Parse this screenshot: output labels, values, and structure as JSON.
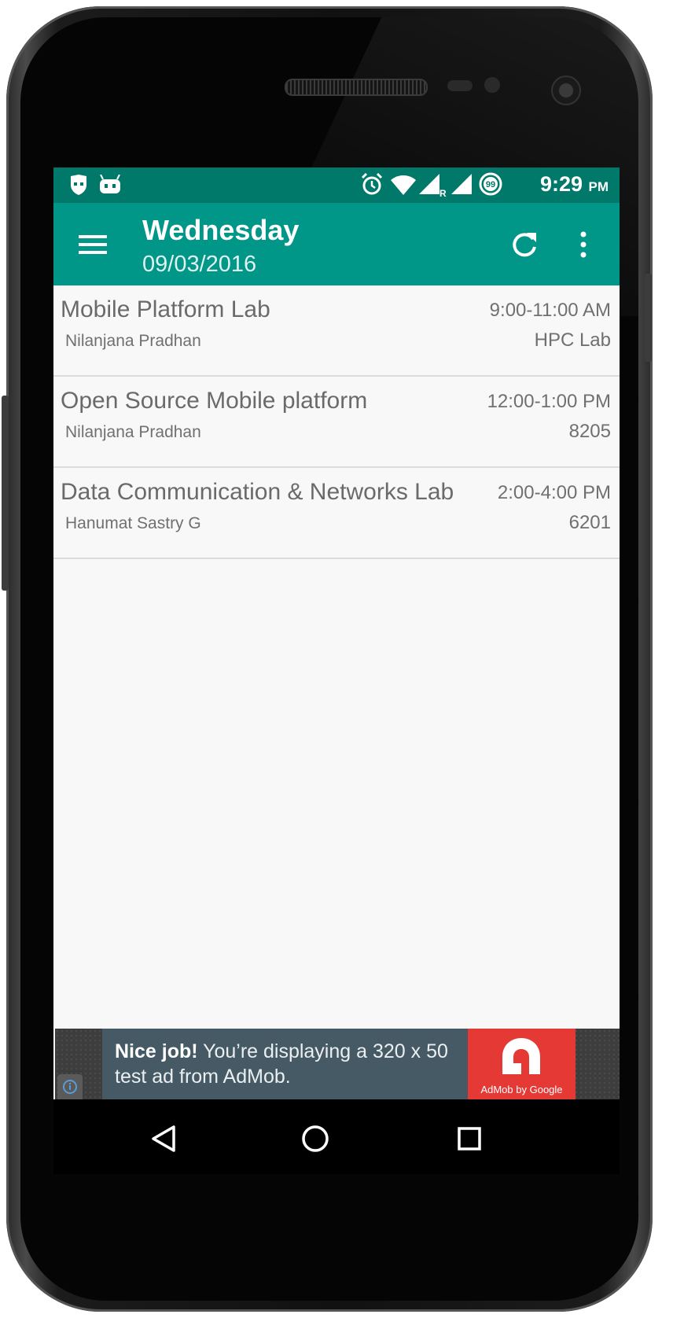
{
  "status_bar": {
    "time": "9:29",
    "ampm": "PM",
    "battery_level": "99",
    "icons": [
      "cyanogenmod-icon",
      "android-debug-icon",
      "alarm-icon",
      "wifi-icon",
      "signal-roaming-icon",
      "signal-icon",
      "battery-icon"
    ]
  },
  "app_bar": {
    "title": "Wednesday",
    "subtitle": "09/03/2016"
  },
  "schedule": [
    {
      "course": "Mobile Platform Lab",
      "professor": "Nilanjana Pradhan",
      "time": "9:00-11:00 AM",
      "room": "HPC Lab"
    },
    {
      "course": "Open Source Mobile platform",
      "professor": "Nilanjana Pradhan",
      "time": "12:00-1:00 PM",
      "room": "8205"
    },
    {
      "course": "Data Communication & Networks Lab",
      "professor": "Hanumat Sastry G",
      "time": "2:00-4:00 PM",
      "room": "6201"
    }
  ],
  "ad": {
    "bold": "Nice job!",
    "text": " You’re displaying a 320 x 50 test ad from AdMob.",
    "brand": "AdMob by Google"
  },
  "colors": {
    "status_bar": "#00796b",
    "app_bar": "#009688",
    "ad_logo": "#e53935"
  }
}
